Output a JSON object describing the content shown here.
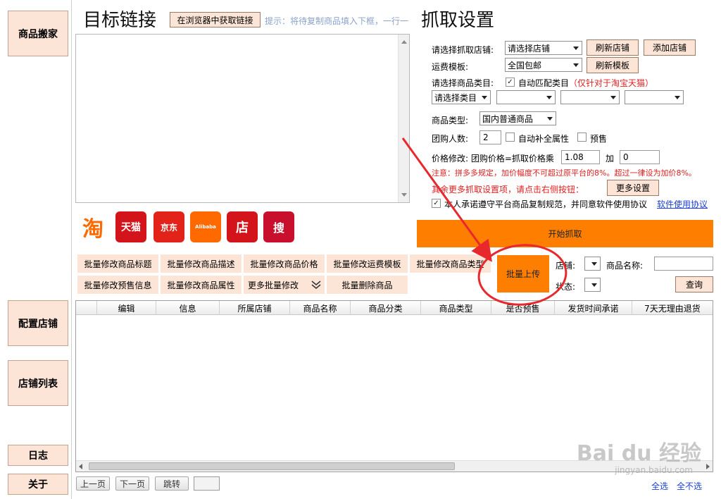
{
  "nav": {
    "merchant": "商品搬家",
    "config_shop": "配置店铺",
    "shop_list": "店铺列表",
    "log": "日志",
    "about": "关于"
  },
  "target": {
    "title": "目标链接",
    "get_link_button": "在浏览器中获取链接",
    "hint": "提示：将待复制商品填入下框，一行一"
  },
  "capture": {
    "title": "抓取设置",
    "shop_label": "请选择抓取店铺:",
    "shop_value": "请选择店铺",
    "refresh_shop": "刷新店铺",
    "add_shop": "添加店铺",
    "shipping_label": "运费模板:",
    "shipping_value": "全国包邮",
    "refresh_template": "刷新模板",
    "category_label": "请选择商品类目:",
    "auto_match": "自动匹配类目",
    "auto_match_note": "（仅针对于淘宝天猫）",
    "category_value": "请选择类目",
    "product_type_label": "商品类型:",
    "product_type_value": "国内普通商品",
    "group_label": "团购人数:",
    "group_value": "2",
    "auto_attr": "自动补全属性",
    "presale": "预售",
    "price_label": "价格修改: 团购价格=抓取价格乘",
    "price_mult": "1.08",
    "plus": "加",
    "price_add": "0",
    "notice": "注意：拼多多规定，加价幅度不可超过原平台的8%。超过一律设为加价8%。",
    "more_hint": "其余更多抓取设置项，请点击右侧按钮：",
    "more_settings": "更多设置",
    "agree": "本人承诺遵守平台商品复制规范，并同意软件使用协议",
    "agreement_link": "软件使用协议",
    "start": "开始抓取"
  },
  "logos": [
    "淘",
    "天猫",
    "京东",
    "Alibaba",
    "店",
    "搜"
  ],
  "toolbar": {
    "edit_title": "批量修改商品标题",
    "edit_desc": "批量修改商品描述",
    "edit_price": "批量修改商品价格",
    "edit_shipping": "批量修改运费模板",
    "edit_type": "批量修改商品类型",
    "edit_presale": "批量修改预售信息",
    "edit_attr": "批量修改商品属性",
    "more_edit": "更多批量修改",
    "delete": "批量删除商品",
    "batch_upload": "批量上传",
    "shop_filter": "店铺:",
    "name_filter": "商品名称:",
    "status_filter": "状态:",
    "query": "查询"
  },
  "table": {
    "columns": [
      "编辑",
      "信息",
      "所属店铺",
      "商品名称",
      "商品分类",
      "商品类型",
      "是否预售",
      "发货时间承诺",
      "7天无理由退货"
    ]
  },
  "pager": {
    "prev": "上一页",
    "next": "下一页",
    "jump": "跳转",
    "select_all": "全选",
    "select_none": "全不选"
  },
  "watermark": {
    "brand": "Bai du 经验",
    "url": "jingyan.baidu.com"
  },
  "colors": {
    "accent_orange": "#fe7f00",
    "peach": "#fce4d6",
    "annotation_red": "#e8282c"
  }
}
